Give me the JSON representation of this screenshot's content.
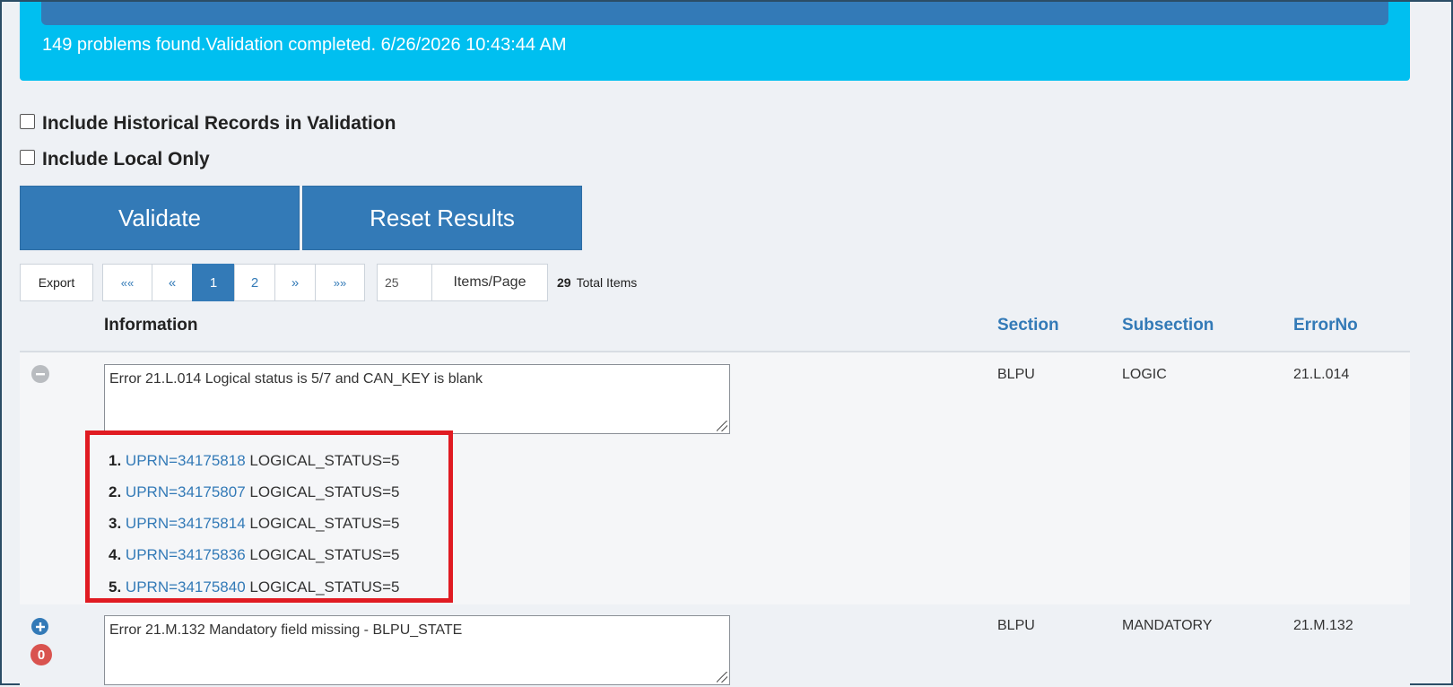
{
  "status": {
    "message": "149 problems found.Validation completed. 6/26/2026 10:43:44 AM"
  },
  "options": {
    "historical_label": "Include Historical Records in Validation",
    "local_only_label": "Include Local Only"
  },
  "actions": {
    "validate_label": "Validate",
    "reset_label": "Reset Results"
  },
  "toolbar": {
    "export_label": "Export",
    "pager": {
      "first": "««",
      "prev": "«",
      "pages": [
        "1",
        "2"
      ],
      "current_page": "1",
      "next": "»",
      "last": "»»"
    },
    "items_per_page_value": "25",
    "items_per_page_label": "Items/Page",
    "total_count": "29",
    "total_label": "Total Items"
  },
  "table": {
    "columns": {
      "information": "Information",
      "section": "Section",
      "subsection": "Subsection",
      "error_no": "ErrorNo"
    },
    "rows": [
      {
        "info": "Error 21.L.014 Logical status is 5/7 and CAN_KEY is blank",
        "section": "BLPU",
        "subsection": "LOGIC",
        "error_no": "21.L.014",
        "expanded": true,
        "details": [
          {
            "num": "1.",
            "uprn": "UPRN=34175818",
            "status": "LOGICAL_STATUS=5"
          },
          {
            "num": "2.",
            "uprn": "UPRN=34175807",
            "status": "LOGICAL_STATUS=5"
          },
          {
            "num": "3.",
            "uprn": "UPRN=34175814",
            "status": "LOGICAL_STATUS=5"
          },
          {
            "num": "4.",
            "uprn": "UPRN=34175836",
            "status": "LOGICAL_STATUS=5"
          },
          {
            "num": "5.",
            "uprn": "UPRN=34175840",
            "status": "LOGICAL_STATUS=5"
          }
        ]
      },
      {
        "info": "Error 21.M.132 Mandatory field missing - BLPU_STATE",
        "section": "BLPU",
        "subsection": "MANDATORY",
        "error_no": "21.M.132",
        "expanded": false,
        "badge": "0"
      }
    ]
  },
  "colors": {
    "banner": "#00bff0",
    "primary": "#337ab7",
    "highlight_border": "#e01b22",
    "badge_red": "#d9534f"
  }
}
